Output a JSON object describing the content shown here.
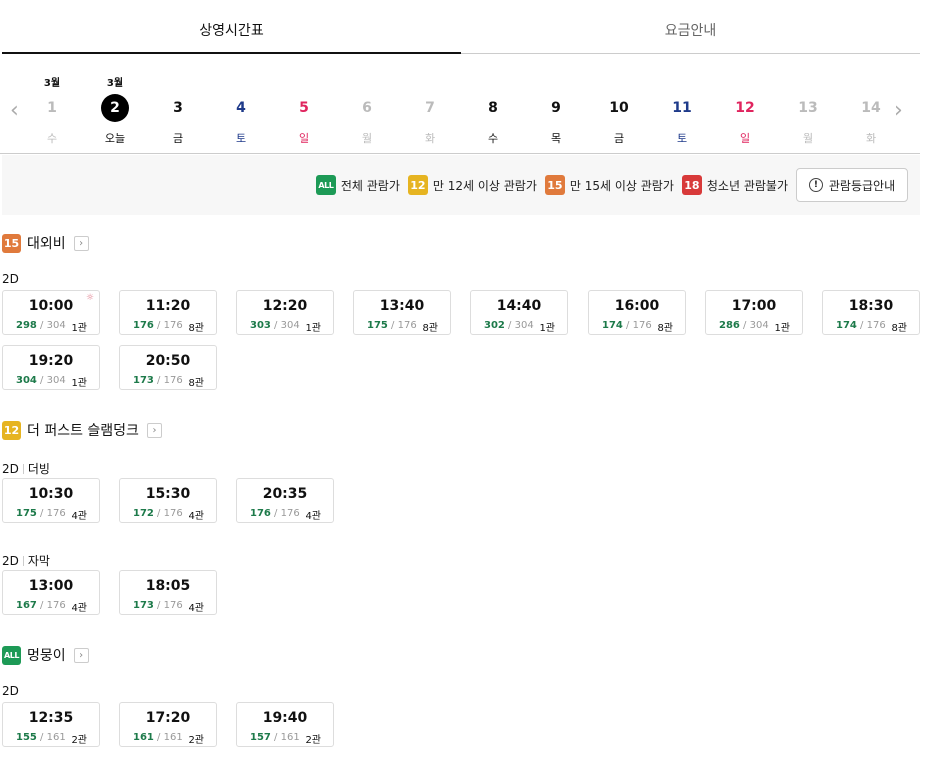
{
  "tabs": [
    {
      "label": "상영시간표",
      "active": true
    },
    {
      "label": "요금안내",
      "active": false
    }
  ],
  "dates": [
    {
      "month": "3월",
      "day": "1",
      "dow": "수",
      "color": "gray",
      "today": false
    },
    {
      "month": "3월",
      "day": "2",
      "dow": "오늘",
      "color": "black",
      "today": true
    },
    {
      "month": "",
      "day": "3",
      "dow": "금",
      "color": "black",
      "today": false
    },
    {
      "month": "",
      "day": "4",
      "dow": "토",
      "color": "blue",
      "today": false
    },
    {
      "month": "",
      "day": "5",
      "dow": "일",
      "color": "red",
      "today": false
    },
    {
      "month": "",
      "day": "6",
      "dow": "월",
      "color": "gray",
      "today": false
    },
    {
      "month": "",
      "day": "7",
      "dow": "화",
      "color": "gray",
      "today": false
    },
    {
      "month": "",
      "day": "8",
      "dow": "수",
      "color": "black",
      "today": false
    },
    {
      "month": "",
      "day": "9",
      "dow": "목",
      "color": "black",
      "today": false
    },
    {
      "month": "",
      "day": "10",
      "dow": "금",
      "color": "black",
      "today": false
    },
    {
      "month": "",
      "day": "11",
      "dow": "토",
      "color": "blue",
      "today": false
    },
    {
      "month": "",
      "day": "12",
      "dow": "일",
      "color": "red",
      "today": false
    },
    {
      "month": "",
      "day": "13",
      "dow": "월",
      "color": "gray",
      "today": false
    },
    {
      "month": "",
      "day": "14",
      "dow": "화",
      "color": "gray",
      "today": false
    }
  ],
  "legend": {
    "items": [
      {
        "badge": "ALL",
        "label": "전체 관람가"
      },
      {
        "badge": "12",
        "label": "만 12세 이상 관람가"
      },
      {
        "badge": "15",
        "label": "만 15세 이상 관람가"
      },
      {
        "badge": "18",
        "label": "청소년 관람불가"
      }
    ],
    "guide_button": "관람등급안내",
    "colors": {
      "ALL": "#1d9a56",
      "12": "#e6b421",
      "15": "#e07a3c",
      "18": "#d83a3a"
    }
  },
  "movies": [
    {
      "title": "대외비",
      "rating": "15",
      "groups": [
        {
          "format": "2D",
          "subtitle": "",
          "slots": [
            {
              "time": "10:00",
              "remain": "298",
              "total": "304",
              "hall": "1관",
              "morning": true
            },
            {
              "time": "11:20",
              "remain": "176",
              "total": "176",
              "hall": "8관",
              "morning": false
            },
            {
              "time": "12:20",
              "remain": "303",
              "total": "304",
              "hall": "1관",
              "morning": false
            },
            {
              "time": "13:40",
              "remain": "175",
              "total": "176",
              "hall": "8관",
              "morning": false
            },
            {
              "time": "14:40",
              "remain": "302",
              "total": "304",
              "hall": "1관",
              "morning": false
            },
            {
              "time": "16:00",
              "remain": "174",
              "total": "176",
              "hall": "8관",
              "morning": false
            },
            {
              "time": "17:00",
              "remain": "286",
              "total": "304",
              "hall": "1관",
              "morning": false
            },
            {
              "time": "18:30",
              "remain": "174",
              "total": "176",
              "hall": "8관",
              "morning": false
            },
            {
              "time": "19:20",
              "remain": "304",
              "total": "304",
              "hall": "1관",
              "morning": false
            },
            {
              "time": "20:50",
              "remain": "173",
              "total": "176",
              "hall": "8관",
              "morning": false
            }
          ]
        }
      ]
    },
    {
      "title": "더 퍼스트 슬램덩크",
      "rating": "12",
      "groups": [
        {
          "format": "2D",
          "subtitle": "더빙",
          "slots": [
            {
              "time": "10:30",
              "remain": "175",
              "total": "176",
              "hall": "4관",
              "morning": false
            },
            {
              "time": "15:30",
              "remain": "172",
              "total": "176",
              "hall": "4관",
              "morning": false
            },
            {
              "time": "20:35",
              "remain": "176",
              "total": "176",
              "hall": "4관",
              "morning": false
            }
          ]
        },
        {
          "format": "2D",
          "subtitle": "자막",
          "slots": [
            {
              "time": "13:00",
              "remain": "167",
              "total": "176",
              "hall": "4관",
              "morning": false
            },
            {
              "time": "18:05",
              "remain": "173",
              "total": "176",
              "hall": "4관",
              "morning": false
            }
          ]
        }
      ]
    },
    {
      "title": "멍뭉이",
      "rating": "ALL",
      "groups": [
        {
          "format": "2D",
          "subtitle": "",
          "slots": [
            {
              "time": "12:35",
              "remain": "155",
              "total": "161",
              "hall": "2관",
              "morning": false
            },
            {
              "time": "17:20",
              "remain": "161",
              "total": "161",
              "hall": "2관",
              "morning": false
            },
            {
              "time": "19:40",
              "remain": "157",
              "total": "161",
              "hall": "2관",
              "morning": false
            }
          ]
        }
      ]
    }
  ]
}
